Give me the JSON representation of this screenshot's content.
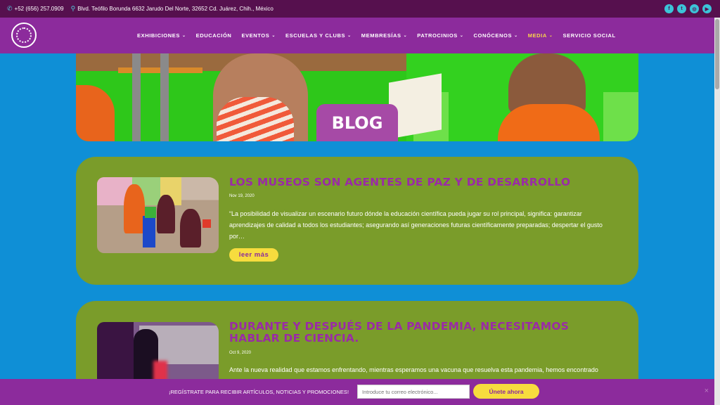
{
  "topbar": {
    "phone": "+52 (656) 257.0909",
    "address": "Blvd. Teófilo Borunda 6632 Jarudo Del Norte, 32652 Cd. Juárez, Chih., México",
    "social": [
      "facebook-icon",
      "twitter-icon",
      "instagram-icon",
      "youtube-icon"
    ]
  },
  "nav": {
    "items": [
      {
        "label": "EXHIBICIONES",
        "dropdown": true
      },
      {
        "label": "EDUCACIÓN",
        "dropdown": false
      },
      {
        "label": "EVENTOS",
        "dropdown": true
      },
      {
        "label": "ESCUELAS Y CLUBS",
        "dropdown": true
      },
      {
        "label": "MEMBRESÍAS",
        "dropdown": true
      },
      {
        "label": "PATROCINIOS",
        "dropdown": true
      },
      {
        "label": "CONÓCENOS",
        "dropdown": true
      },
      {
        "label": "MEDIA",
        "dropdown": true,
        "active": true
      },
      {
        "label": "SERVICIO SOCIAL",
        "dropdown": false
      }
    ]
  },
  "hero": {
    "title": "BLOG"
  },
  "posts": [
    {
      "title": "LOS MUSEOS SON AGENTES DE PAZ Y DE DESARROLLO",
      "date": "Nov 19, 2020",
      "excerpt": "“La posibilidad de visualizar un escenario futuro dónde la educación científica pueda jugar su rol principal, significa: garantizar aprendizajes de calidad a todos los estudiantes; asegurando así generaciones futuras científicamente preparadas; despertar el gusto por…",
      "read_more": "leer más"
    },
    {
      "title": "DURANTE Y DESPUÉS DE LA PANDEMIA, NECESITAMOS HABLAR DE CIENCIA.",
      "date": "Oct 9, 2020",
      "excerpt": "Ante la nueva realidad que estamos enfrentando, mientras esperamos una vacuna que resuelva esta pandemia, hemos encontrado"
    }
  ],
  "subscribe": {
    "label": "¡REGÍSTRATE PARA RECIBIR ARTÍCULOS, NOTICIAS Y PROMOCIONES!",
    "placeholder": "Introduce tu correo electrónico...",
    "button": "Únete ahora",
    "close": "×"
  },
  "colors": {
    "background": "#0f8fd6",
    "nav": "#8c2b9c",
    "topbar": "#56104e",
    "card": "#7a9c2a",
    "accent": "#f7dc3e",
    "title": "#9a2ba6"
  }
}
